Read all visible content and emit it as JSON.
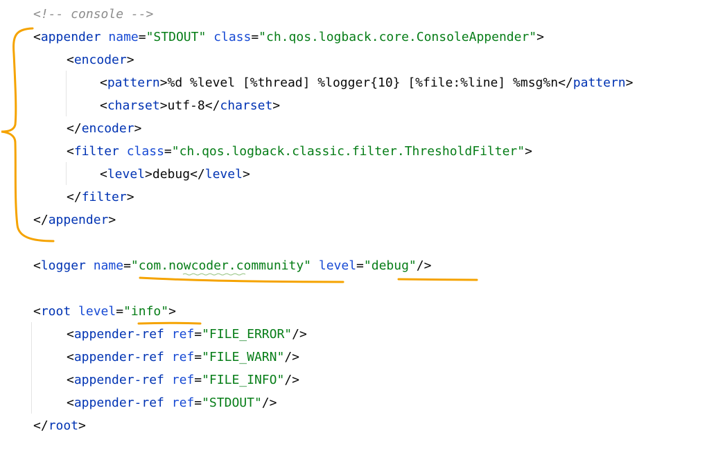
{
  "lines": [
    {
      "indent": 0,
      "tokens": [
        {
          "t": "comment",
          "v": "<!-- console -->"
        }
      ]
    },
    {
      "indent": 0,
      "tokens": [
        {
          "t": "punct",
          "v": "<"
        },
        {
          "t": "tag",
          "v": "appender"
        },
        {
          "t": "punct",
          "v": " "
        },
        {
          "t": "attr",
          "v": "name"
        },
        {
          "t": "punct",
          "v": "="
        },
        {
          "t": "value",
          "v": "\"STDOUT\""
        },
        {
          "t": "punct",
          "v": " "
        },
        {
          "t": "attr",
          "v": "class"
        },
        {
          "t": "punct",
          "v": "="
        },
        {
          "t": "value",
          "v": "\"ch.qos.logback.core.ConsoleAppender\""
        },
        {
          "t": "punct",
          "v": ">"
        }
      ]
    },
    {
      "indent": 1,
      "tokens": [
        {
          "t": "punct",
          "v": "<"
        },
        {
          "t": "tag",
          "v": "encoder"
        },
        {
          "t": "punct",
          "v": ">"
        }
      ]
    },
    {
      "indent": 2,
      "tokens": [
        {
          "t": "punct",
          "v": "<"
        },
        {
          "t": "tag",
          "v": "pattern"
        },
        {
          "t": "punct",
          "v": ">"
        },
        {
          "t": "text",
          "v": "%d %level [%thread] %logger{10} [%file:%line] %msg%n"
        },
        {
          "t": "punct",
          "v": "</"
        },
        {
          "t": "tag",
          "v": "pattern"
        },
        {
          "t": "punct",
          "v": ">"
        }
      ]
    },
    {
      "indent": 2,
      "tokens": [
        {
          "t": "punct",
          "v": "<"
        },
        {
          "t": "tag",
          "v": "charset"
        },
        {
          "t": "punct",
          "v": ">"
        },
        {
          "t": "text",
          "v": "utf-8"
        },
        {
          "t": "punct",
          "v": "</"
        },
        {
          "t": "tag",
          "v": "charset"
        },
        {
          "t": "punct",
          "v": ">"
        }
      ]
    },
    {
      "indent": 1,
      "tokens": [
        {
          "t": "punct",
          "v": "</"
        },
        {
          "t": "tag",
          "v": "encoder"
        },
        {
          "t": "punct",
          "v": ">"
        }
      ]
    },
    {
      "indent": 1,
      "tokens": [
        {
          "t": "punct",
          "v": "<"
        },
        {
          "t": "tag",
          "v": "filter"
        },
        {
          "t": "punct",
          "v": " "
        },
        {
          "t": "attr",
          "v": "class"
        },
        {
          "t": "punct",
          "v": "="
        },
        {
          "t": "value",
          "v": "\"ch.qos.logback.classic.filter.ThresholdFilter\""
        },
        {
          "t": "punct",
          "v": ">"
        }
      ]
    },
    {
      "indent": 2,
      "tokens": [
        {
          "t": "punct",
          "v": "<"
        },
        {
          "t": "tag",
          "v": "level"
        },
        {
          "t": "punct",
          "v": ">"
        },
        {
          "t": "text",
          "v": "debug"
        },
        {
          "t": "punct",
          "v": "</"
        },
        {
          "t": "tag",
          "v": "level"
        },
        {
          "t": "punct",
          "v": ">"
        }
      ]
    },
    {
      "indent": 1,
      "tokens": [
        {
          "t": "punct",
          "v": "</"
        },
        {
          "t": "tag",
          "v": "filter"
        },
        {
          "t": "punct",
          "v": ">"
        }
      ]
    },
    {
      "indent": 0,
      "tokens": [
        {
          "t": "punct",
          "v": "</"
        },
        {
          "t": "tag",
          "v": "appender"
        },
        {
          "t": "punct",
          "v": ">"
        }
      ]
    },
    {
      "indent": 0,
      "tokens": []
    },
    {
      "indent": 0,
      "tokens": [
        {
          "t": "punct",
          "v": "<"
        },
        {
          "t": "tag",
          "v": "logger"
        },
        {
          "t": "punct",
          "v": " "
        },
        {
          "t": "attr",
          "v": "name"
        },
        {
          "t": "punct",
          "v": "="
        },
        {
          "t": "value",
          "v": "\"com.nowcoder.community\""
        },
        {
          "t": "punct",
          "v": " "
        },
        {
          "t": "attr",
          "v": "level"
        },
        {
          "t": "punct",
          "v": "="
        },
        {
          "t": "value",
          "v": "\"debug\""
        },
        {
          "t": "punct",
          "v": "/>"
        }
      ]
    },
    {
      "indent": 0,
      "tokens": []
    },
    {
      "indent": 0,
      "tokens": [
        {
          "t": "punct",
          "v": "<"
        },
        {
          "t": "tag",
          "v": "root"
        },
        {
          "t": "punct",
          "v": " "
        },
        {
          "t": "attr",
          "v": "level"
        },
        {
          "t": "punct",
          "v": "="
        },
        {
          "t": "value",
          "v": "\"info\""
        },
        {
          "t": "punct",
          "v": ">"
        }
      ]
    },
    {
      "indent": 1,
      "tokens": [
        {
          "t": "punct",
          "v": "<"
        },
        {
          "t": "tag",
          "v": "appender-ref"
        },
        {
          "t": "punct",
          "v": " "
        },
        {
          "t": "attr",
          "v": "ref"
        },
        {
          "t": "punct",
          "v": "="
        },
        {
          "t": "value",
          "v": "\"FILE_ERROR\""
        },
        {
          "t": "punct",
          "v": "/>"
        }
      ]
    },
    {
      "indent": 1,
      "tokens": [
        {
          "t": "punct",
          "v": "<"
        },
        {
          "t": "tag",
          "v": "appender-ref"
        },
        {
          "t": "punct",
          "v": " "
        },
        {
          "t": "attr",
          "v": "ref"
        },
        {
          "t": "punct",
          "v": "="
        },
        {
          "t": "value",
          "v": "\"FILE_WARN\""
        },
        {
          "t": "punct",
          "v": "/>"
        }
      ]
    },
    {
      "indent": 1,
      "tokens": [
        {
          "t": "punct",
          "v": "<"
        },
        {
          "t": "tag",
          "v": "appender-ref"
        },
        {
          "t": "punct",
          "v": " "
        },
        {
          "t": "attr",
          "v": "ref"
        },
        {
          "t": "punct",
          "v": "="
        },
        {
          "t": "value",
          "v": "\"FILE_INFO\""
        },
        {
          "t": "punct",
          "v": "/>"
        }
      ]
    },
    {
      "indent": 1,
      "tokens": [
        {
          "t": "punct",
          "v": "<"
        },
        {
          "t": "tag",
          "v": "appender-ref"
        },
        {
          "t": "punct",
          "v": " "
        },
        {
          "t": "attr",
          "v": "ref"
        },
        {
          "t": "punct",
          "v": "="
        },
        {
          "t": "value",
          "v": "\"STDOUT\""
        },
        {
          "t": "punct",
          "v": "/>"
        }
      ]
    },
    {
      "indent": 0,
      "tokens": [
        {
          "t": "punct",
          "v": "</"
        },
        {
          "t": "tag",
          "v": "root"
        },
        {
          "t": "punct",
          "v": ">"
        }
      ]
    }
  ],
  "colors": {
    "tag": "#0033b3",
    "attr": "#174ad4",
    "value": "#067d17",
    "comment": "#8c8c8c",
    "text": "#080808",
    "annotation": "#f5a300",
    "indent_guide": "#e4e4e4"
  }
}
